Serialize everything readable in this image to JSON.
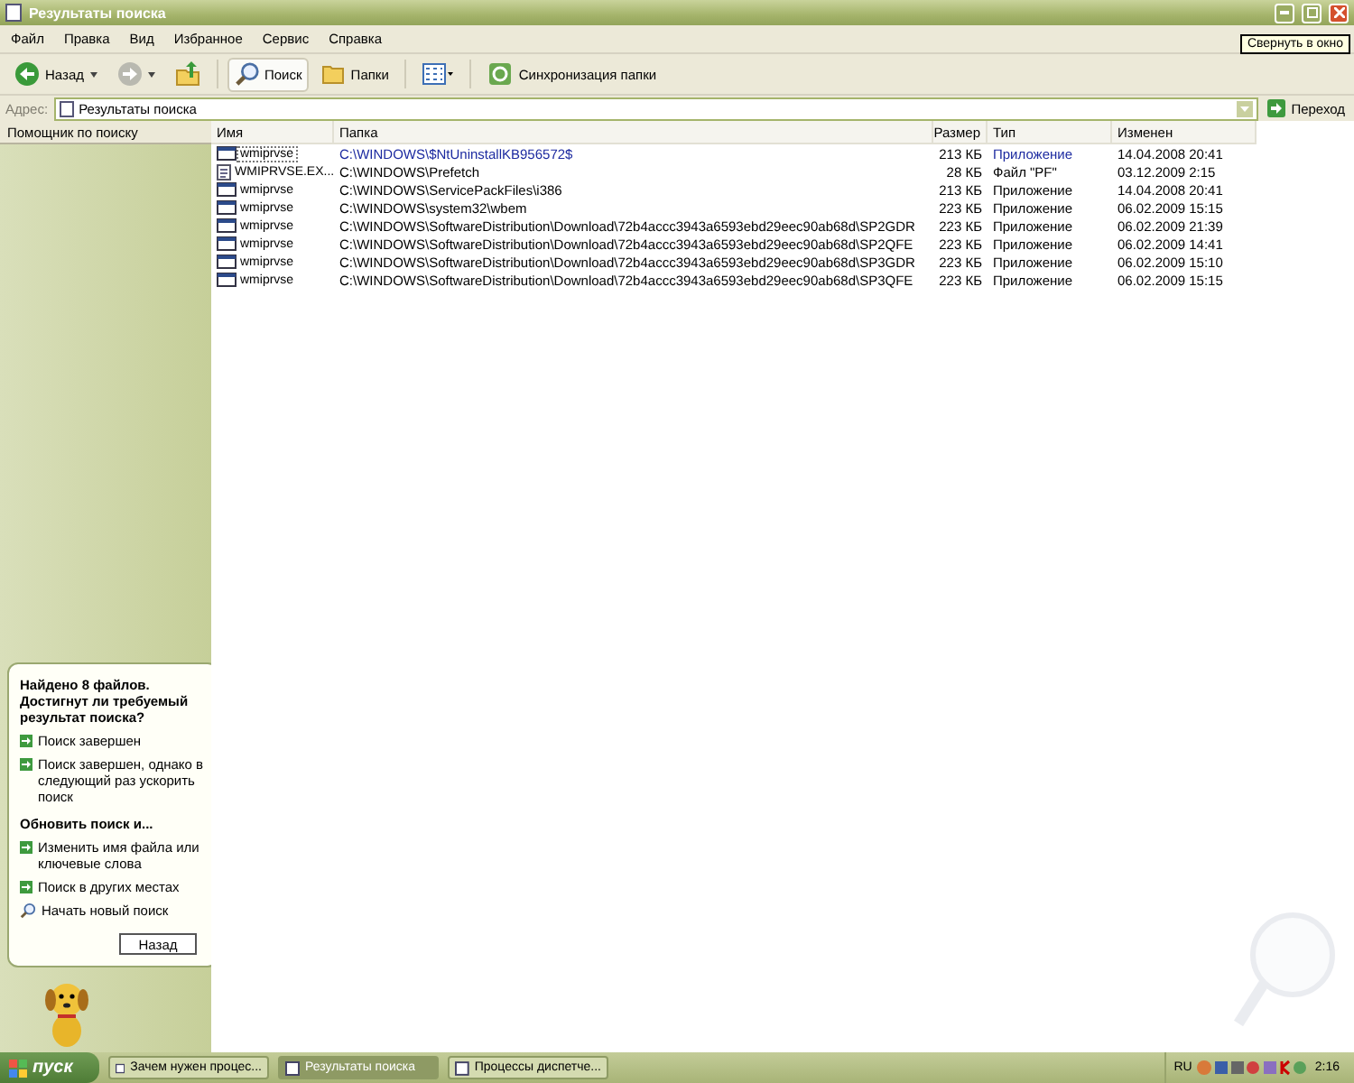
{
  "window": {
    "title": "Результаты поиска",
    "tooltip": "Свернуть в окно"
  },
  "menu": [
    "Файл",
    "Правка",
    "Вид",
    "Избранное",
    "Сервис",
    "Справка"
  ],
  "toolbar": [
    {
      "kind": "back",
      "label": "Назад"
    },
    {
      "kind": "forward"
    },
    {
      "kind": "up"
    },
    {
      "kind": "search",
      "label": "Поиск",
      "selected": true
    },
    {
      "kind": "folders",
      "label": "Папки",
      "selected": false
    },
    {
      "kind": "views"
    },
    {
      "kind": "sync",
      "label": "Синхронизация папки"
    }
  ],
  "address": {
    "label": "Адрес:",
    "value": "Результаты поиска",
    "go": "Переход"
  },
  "sidebar": {
    "title": "Помощник по поиску",
    "balloon": {
      "heading": "Найдено 8 файлов. Достигнут ли требуемый результат поиска?",
      "items": [
        {
          "kind": "arrow",
          "label": "Поиск завершен"
        },
        {
          "kind": "arrow",
          "label": "Поиск завершен, однако в следующий раз ускорить поиск"
        },
        {
          "kind": "section",
          "label": "Обновить поиск и..."
        },
        {
          "kind": "arrow",
          "label": "Изменить имя файла или ключевые слова"
        },
        {
          "kind": "arrow",
          "label": "Поиск в других местах"
        },
        {
          "kind": "search",
          "label": "Начать новый поиск"
        }
      ],
      "button": "Назад"
    }
  },
  "table": {
    "columns": [
      "Имя",
      "Папка",
      "Размер",
      "Тип",
      "Изменен"
    ],
    "rows": [
      {
        "kind": "app",
        "focused": true,
        "cells": [
          "wmiprvse",
          "C:\\WINDOWS\\$NtUninstallKB956572$",
          "213 КБ",
          "Приложение",
          "14.04.2008 20:41"
        ]
      },
      {
        "kind": "pf",
        "focused": false,
        "cells": [
          "WMIPRVSE.EX...",
          "C:\\WINDOWS\\Prefetch",
          "28 КБ",
          "Файл \"PF\"",
          "03.12.2009 2:15"
        ]
      },
      {
        "kind": "app",
        "focused": false,
        "cells": [
          "wmiprvse",
          "C:\\WINDOWS\\ServicePackFiles\\i386",
          "213 КБ",
          "Приложение",
          "14.04.2008 20:41"
        ]
      },
      {
        "kind": "app",
        "focused": false,
        "cells": [
          "wmiprvse",
          "C:\\WINDOWS\\system32\\wbem",
          "223 КБ",
          "Приложение",
          "06.02.2009 15:15"
        ]
      },
      {
        "kind": "app",
        "focused": false,
        "cells": [
          "wmiprvse",
          "C:\\WINDOWS\\SoftwareDistribution\\Download\\72b4accc3943a6593ebd29eec90ab68d\\SP2GDR",
          "223 КБ",
          "Приложение",
          "06.02.2009 21:39"
        ]
      },
      {
        "kind": "app",
        "focused": false,
        "cells": [
          "wmiprvse",
          "C:\\WINDOWS\\SoftwareDistribution\\Download\\72b4accc3943a6593ebd29eec90ab68d\\SP2QFE",
          "223 КБ",
          "Приложение",
          "06.02.2009 14:41"
        ]
      },
      {
        "kind": "app",
        "focused": false,
        "cells": [
          "wmiprvse",
          "C:\\WINDOWS\\SoftwareDistribution\\Download\\72b4accc3943a6593ebd29eec90ab68d\\SP3GDR",
          "223 КБ",
          "Приложение",
          "06.02.2009 15:10"
        ]
      },
      {
        "kind": "app",
        "focused": false,
        "cells": [
          "wmiprvse",
          "C:\\WINDOWS\\SoftwareDistribution\\Download\\72b4accc3943a6593ebd29eec90ab68d\\SP3QFE",
          "223 КБ",
          "Приложение",
          "06.02.2009 15:15"
        ]
      }
    ]
  },
  "taskbar": {
    "start": "пуск",
    "tasks": [
      {
        "label": "Зачем нужен процес...",
        "selected": false
      },
      {
        "label": "Результаты поиска",
        "selected": true
      },
      {
        "label": "Процессы диспетче...",
        "selected": false
      }
    ],
    "language": "RU",
    "clock": "2:16"
  }
}
